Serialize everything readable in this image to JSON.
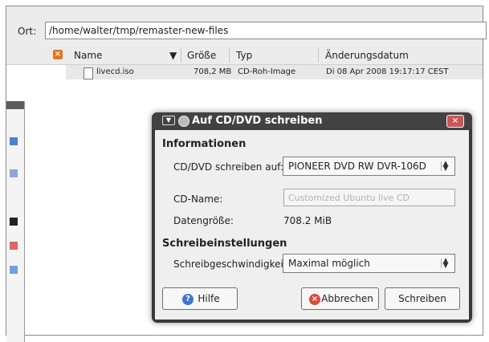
{
  "location": {
    "label": "Ort:",
    "path": "/home/walter/tmp/remaster-new-files"
  },
  "columns": {
    "name": "Name",
    "size": "Größe",
    "type": "Typ",
    "modified": "Änderungsdatum"
  },
  "files": [
    {
      "name": "livecd.iso",
      "size": "708,2 MB",
      "type": "CD-Roh-Image",
      "modified": "Di 08 Apr 2008 19:17:17 CEST"
    }
  ],
  "dialog": {
    "title": "Auf CD/DVD schreiben",
    "section_info": "Informationen",
    "burn_to_label": "CD/DVD schreiben auf:",
    "burn_to_value": "PIONEER DVD RW DVR-106D",
    "cd_name_label": "CD-Name:",
    "cd_name_placeholder": "Customized Ubuntu live CD",
    "size_label": "Datengröße:",
    "size_value": "708.2 MiB",
    "section_settings": "Schreibeinstellungen",
    "speed_label": "Schreibgeschwindigkeit:",
    "speed_value": "Maximal möglich",
    "help_button": "Hilfe",
    "cancel_button": "Abbrechen",
    "burn_button": "Schreiben"
  }
}
